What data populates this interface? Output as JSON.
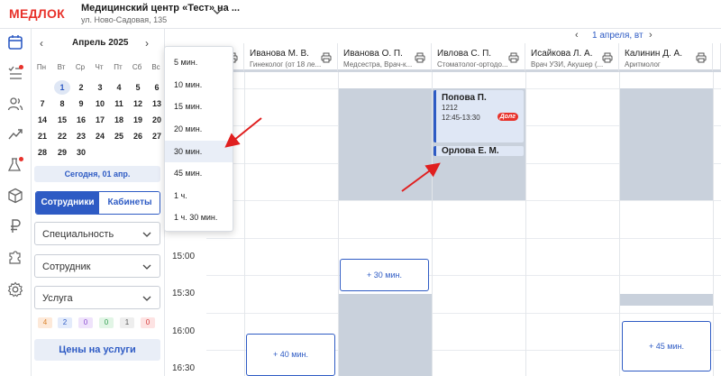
{
  "header": {
    "logo": "МЕДЛОК",
    "clinic_name": "Медицинский центр «Тест» на ...",
    "clinic_address": "ул. Ново-Садовая, 135"
  },
  "rail_icons": [
    "calendar-icon",
    "tasks-icon",
    "users-icon",
    "chart-icon",
    "lab-flask-icon",
    "box-icon",
    "ruble-icon",
    "puzzle-icon",
    "settings-icon"
  ],
  "calendar": {
    "month": "Апрель 2025",
    "prev": "‹",
    "next": "›",
    "weekdays": [
      "Пн",
      "Вт",
      "Ср",
      "Чт",
      "Пт",
      "Сб",
      "Вс"
    ],
    "weeks": [
      [
        "",
        "1",
        "2",
        "3",
        "4",
        "5",
        "6"
      ],
      [
        "7",
        "8",
        "9",
        "10",
        "11",
        "12",
        "13"
      ],
      [
        "14",
        "15",
        "16",
        "17",
        "18",
        "19",
        "20"
      ],
      [
        "21",
        "22",
        "23",
        "24",
        "25",
        "26",
        "27"
      ],
      [
        "28",
        "29",
        "30",
        "",
        "",
        "",
        ""
      ]
    ],
    "today_button": "Сегодня, 01 апр."
  },
  "view_toggle": {
    "staff": "Сотрудники",
    "rooms": "Кабинеты"
  },
  "filters": {
    "specialty": "Специальность",
    "employee": "Сотрудник",
    "service": "Услуга"
  },
  "status_badges": [
    {
      "count": "4",
      "bg": "#fde9d9",
      "fg": "#d9822b"
    },
    {
      "count": "2",
      "bg": "#e3ebfb",
      "fg": "#2e5bc4"
    },
    {
      "count": "0",
      "bg": "#efe3fb",
      "fg": "#8a4bd1"
    },
    {
      "count": "0",
      "bg": "#e2f5e6",
      "fg": "#2f9e4f"
    },
    {
      "count": "1",
      "bg": "#eeeeee",
      "fg": "#555555"
    },
    {
      "count": "0",
      "bg": "#fde3e3",
      "fg": "#d63a3a"
    }
  ],
  "prices_button": "Цены на услуги",
  "date_nav": {
    "label": "1 апреля, вт",
    "prev": "‹",
    "next": "›"
  },
  "columns": [
    {
      "name": "",
      "specialty": ""
    },
    {
      "name": "Иванова М. В.",
      "specialty": "Гинеколог (от 18 ле..."
    },
    {
      "name": "Иванова О. П.",
      "specialty": "Медсестра, Врач-к..."
    },
    {
      "name": "Ивлова С. П.",
      "specialty": "Стоматолог-ортодо..."
    },
    {
      "name": "Исайкова Л. А.",
      "specialty": "Врач УЗИ, Акушер (..."
    },
    {
      "name": "Калинин Д. А.",
      "specialty": "Аритмолог"
    }
  ],
  "time_labels": [
    "15:00",
    "15:30",
    "16:00",
    "16:30"
  ],
  "appointments": [
    {
      "patient": "Попова П.",
      "code": "1212",
      "time": "12:45-13:30",
      "badge": "Долг"
    },
    {
      "patient": "Орлова Е. М."
    }
  ],
  "add_slots": [
    "+ 30 мин.",
    "+ 40 мин.",
    "+ 45 мин."
  ],
  "duration_menu": {
    "options": [
      "5 мин.",
      "10 мин.",
      "15 мин.",
      "20 мин.",
      "30 мин.",
      "45 мин.",
      "1 ч.",
      "1 ч. 30 мин."
    ],
    "selected": "30 мин."
  },
  "colors": {
    "accent": "#2e5bc4",
    "brand": "#e8322b",
    "blocked": "#c9d1dc",
    "annotation_arrow": "#e01f1f"
  }
}
